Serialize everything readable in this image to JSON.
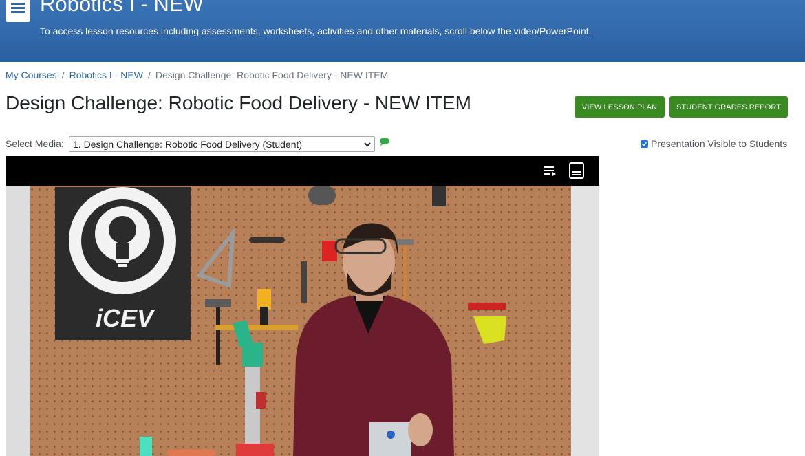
{
  "header": {
    "title": "Robotics I - NEW",
    "subtitle": "To access lesson resources including assessments, worksheets, activities and other materials, scroll below the video/PowerPoint."
  },
  "breadcrumb": {
    "items": [
      "My Courses",
      "Robotics I - NEW"
    ],
    "current": "Design Challenge: Robotic Food Delivery - NEW ITEM"
  },
  "page_title": "Design Challenge: Robotic Food Delivery - NEW ITEM",
  "buttons": {
    "view_lesson_plan": "VIEW LESSON PLAN",
    "student_grades_report": "STUDENT GRADES REPORT"
  },
  "media": {
    "label": "Select Media:",
    "selected": "1. Design Challenge: Robotic Food Delivery (Student)"
  },
  "presentation_visible": {
    "label": "Presentation Visible to Students",
    "checked": true
  },
  "video": {
    "logo_text": "iCEV"
  },
  "colors": {
    "banner": "#2f66a8",
    "button_green": "#3a8a22",
    "link_blue": "#2a62a6",
    "chat_green": "#3aa64a",
    "pegboard": "#b88058"
  }
}
